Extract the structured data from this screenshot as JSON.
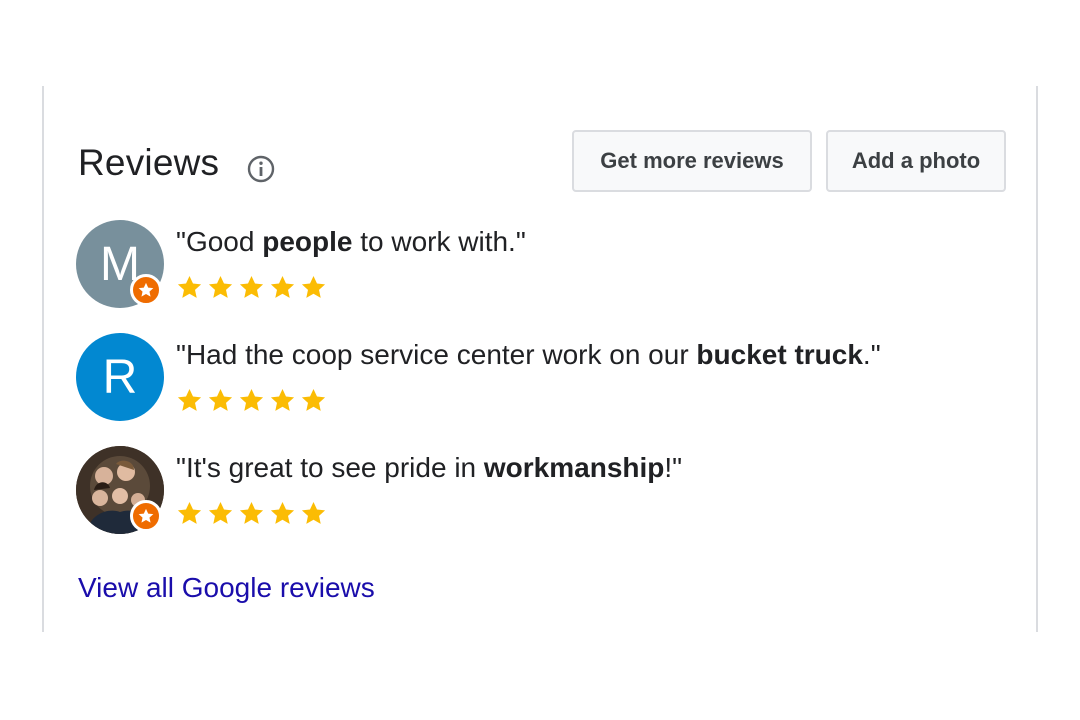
{
  "header": {
    "title": "Reviews",
    "info_icon": "info-circle-icon",
    "buttons": {
      "get_more_reviews": "Get more reviews",
      "add_photo": "Add a photo"
    }
  },
  "reviews": [
    {
      "avatar_letter": "M",
      "avatar_color": "#78909c",
      "local_guide_badge": true,
      "quote_prefix": "\"Good ",
      "quote_bold": "people",
      "quote_suffix": " to work with.\"",
      "rating": 5
    },
    {
      "avatar_letter": "R",
      "avatar_color": "#0288d1",
      "local_guide_badge": false,
      "quote_prefix": "\"Had the coop service center work on our ",
      "quote_bold": "bucket truck",
      "quote_suffix": ".\"",
      "rating": 5
    },
    {
      "avatar_letter": "",
      "avatar_color": "#4a3b2e",
      "avatar_kind": "photo",
      "local_guide_badge": true,
      "quote_prefix": "\"It's great to see pride in ",
      "quote_bold": "workmanship",
      "quote_suffix": "!\"",
      "rating": 5
    }
  ],
  "footer": {
    "view_all_link": "View all Google reviews"
  },
  "colors": {
    "star": "#fbbc04",
    "link": "#1a0dab",
    "badge": "#ef6c00"
  }
}
